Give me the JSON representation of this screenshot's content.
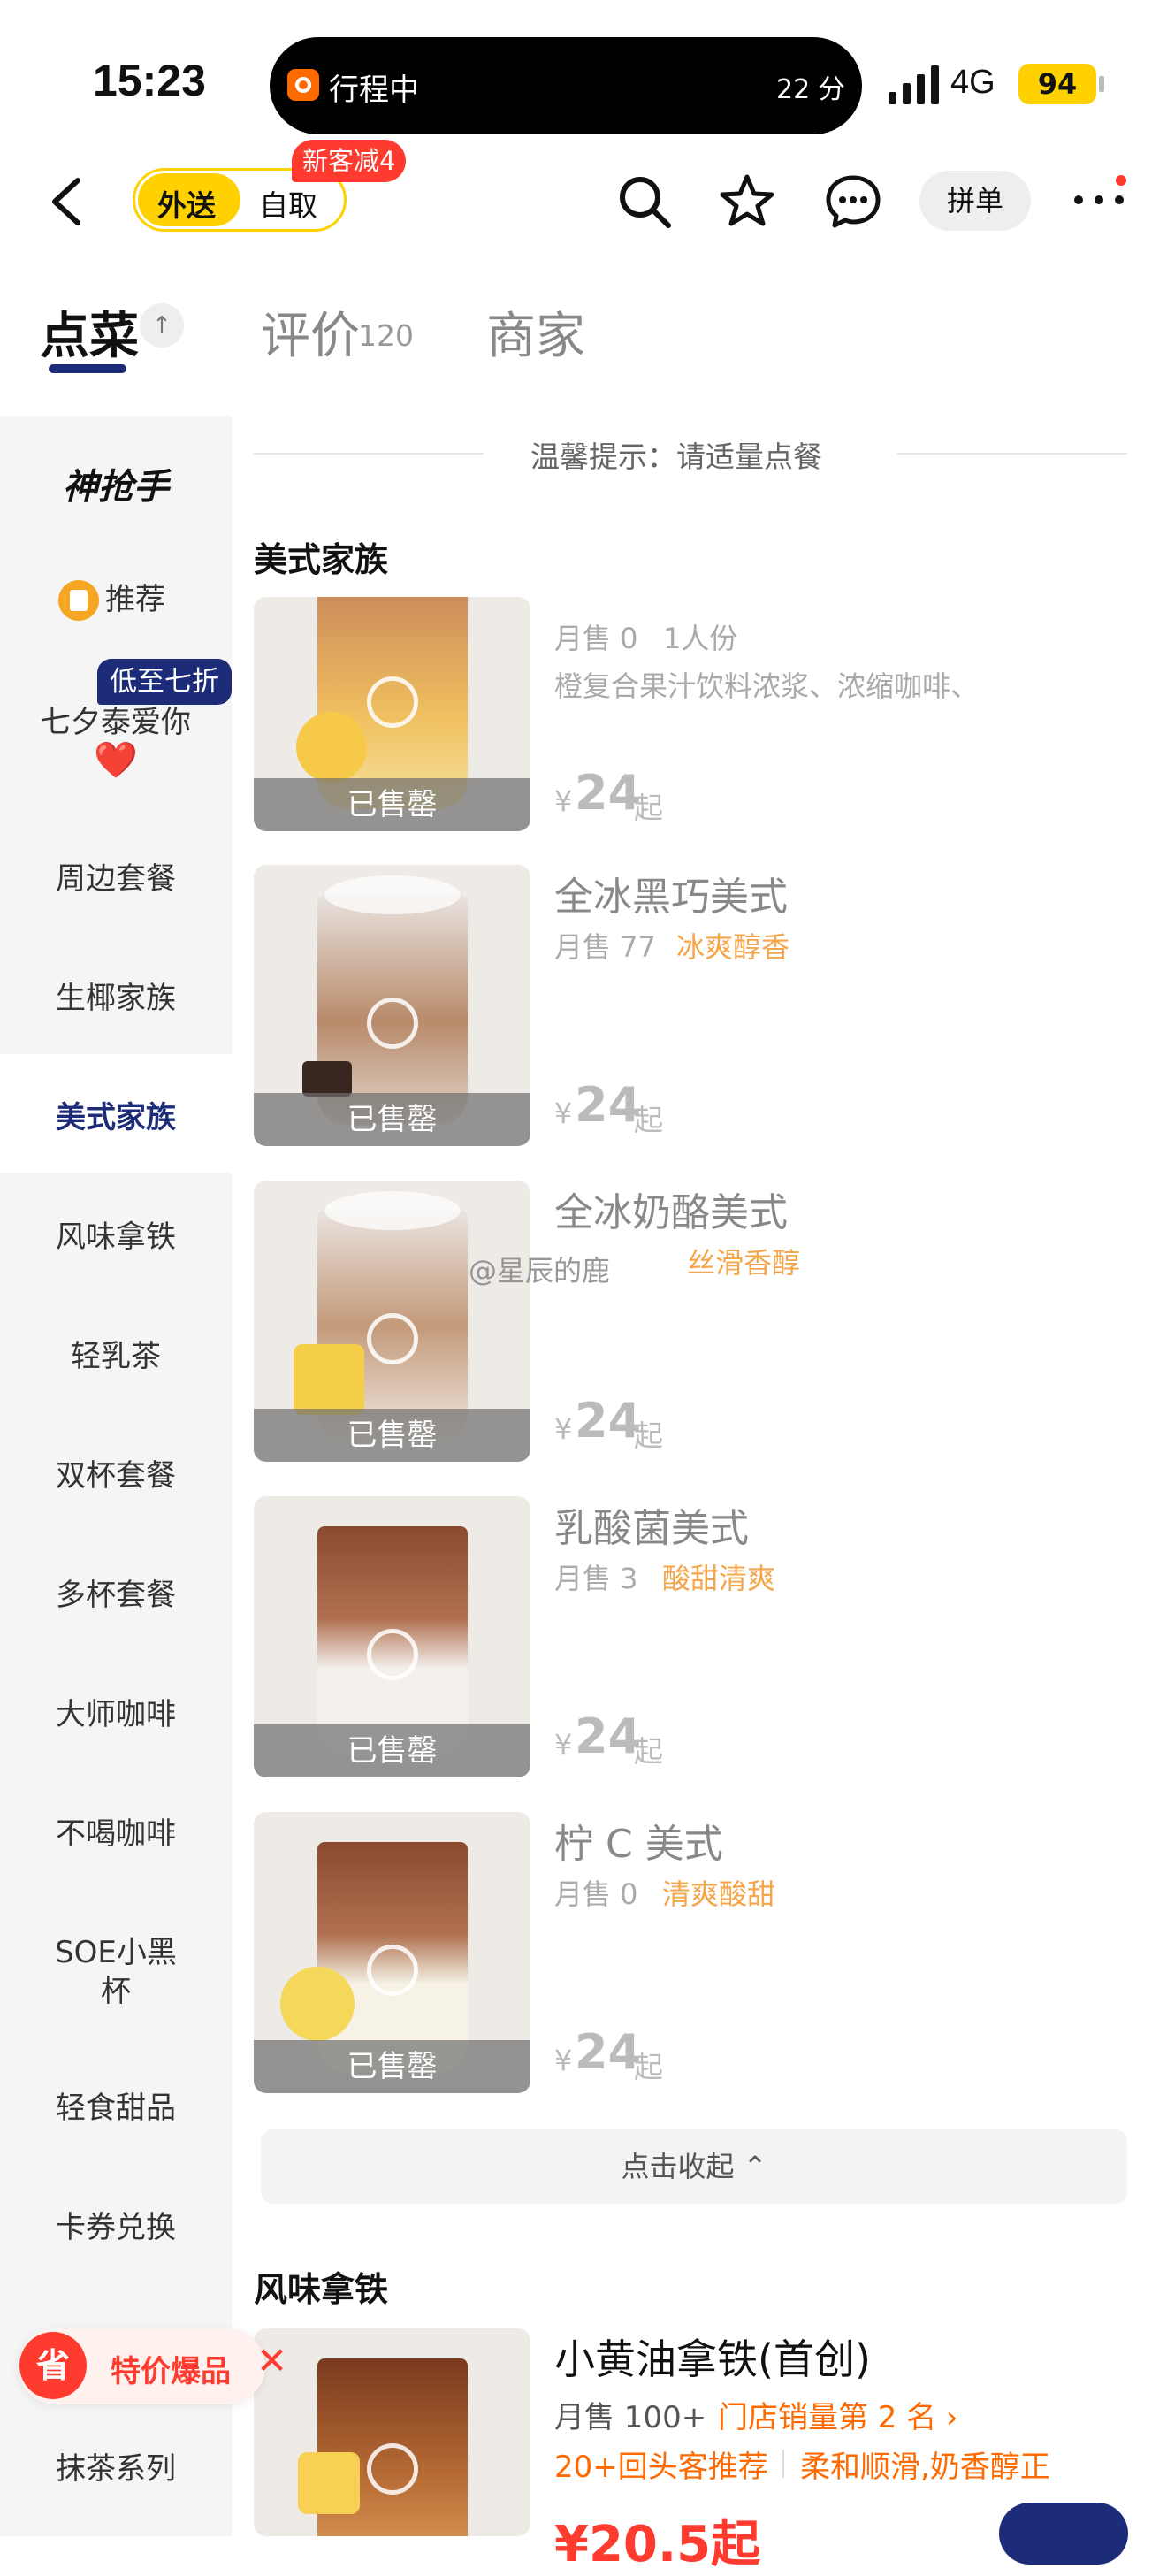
{
  "status_bar": {
    "time": "15:23",
    "activity_title": "行程中",
    "activity_time": "22 分",
    "network": "4G",
    "battery": "94"
  },
  "header": {
    "delivery_option": "外送",
    "pickup_option": "自取",
    "promo_badge": "新客减4",
    "group_order": "拼单",
    "icons": [
      "back-icon",
      "search-icon",
      "star-icon",
      "chat-icon",
      "more-icon"
    ]
  },
  "tabs": [
    {
      "label": "点菜"
    },
    {
      "label": "评价",
      "count": "120"
    },
    {
      "label": "商家"
    }
  ],
  "pin_icon": "↑",
  "sidebar": {
    "logo": "神抢手",
    "items": [
      "推荐",
      "七夕泰爱你",
      "周边套餐",
      "生椰家族",
      "美式家族",
      "风味拿铁",
      "轻乳茶",
      "双杯套餐",
      "多杯套餐",
      "大师咖啡",
      "不喝咖啡",
      "SOE小黑杯",
      "轻食甜品",
      "卡券兑换",
      "抹茶系列"
    ],
    "heart": "❤️",
    "discount_badge": "低至七折",
    "active": "美式家族"
  },
  "notice": "温馨提示：请适量点餐",
  "section_title": "美式家族",
  "sold_out_label": "已售罄",
  "price_symbol": "¥",
  "price_suffix": "起",
  "products": [
    {
      "name": "",
      "sales": "月售 0",
      "tag": "1人份",
      "desc": "橙复合果汁饮料浓浆、浓缩咖啡、",
      "price": "24"
    },
    {
      "name": "全冰黑巧美式",
      "sales": "月售 77",
      "tag": "冰爽醇香",
      "price": "24"
    },
    {
      "name": "全冰奶酪美式",
      "sales": "",
      "tag": "丝滑香醇",
      "price": "24"
    },
    {
      "name": "乳酸菌美式",
      "sales": "月售 3",
      "tag": "酸甜清爽",
      "price": "24"
    },
    {
      "name": "柠 C 美式",
      "sales": "月售 0",
      "tag": "清爽酸甜",
      "price": "24"
    }
  ],
  "collapse_label": "点击收起 ⌃",
  "section2_title": "风味拿铁",
  "featured": {
    "name": "小黄油拿铁(首创)",
    "sales": "月售 100+",
    "rank": "门店销量第 2 名 ›",
    "reviews": "20+回头客推荐",
    "tagline": "柔和顺滑,奶香醇正",
    "price": "¥20.5起"
  },
  "deal": {
    "icon_text": "省",
    "label": "特价爆品",
    "close": "✕"
  },
  "watermark": "@星辰的鹿",
  "colors": {
    "brand": "#1d2c78",
    "accent": "#ffd100",
    "red": "#ff3b30",
    "orange": "#ff6a00"
  }
}
